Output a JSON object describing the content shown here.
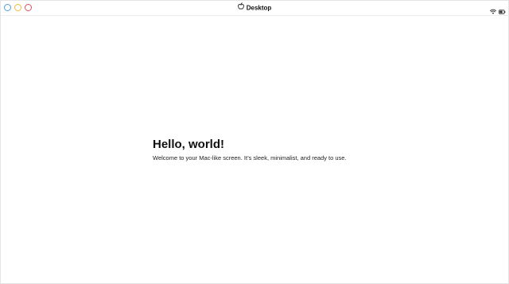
{
  "window": {
    "title": "Desktop",
    "traffic_lights": [
      {
        "name": "close",
        "color": "#4a9fd8"
      },
      {
        "name": "minimize",
        "color": "#f2b63c"
      },
      {
        "name": "zoom",
        "color": "#e0505a"
      }
    ]
  },
  "status_icons": [
    "wifi-icon",
    "battery-icon"
  ],
  "main": {
    "heading": "Hello, world!",
    "text": "Welcome to your Mac-like screen. It’s sleek, minimalist, and ready to use."
  }
}
